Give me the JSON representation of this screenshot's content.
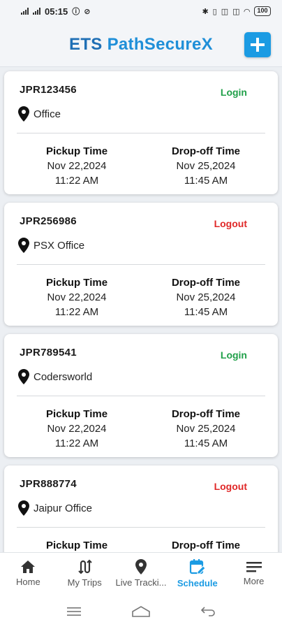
{
  "status_bar": {
    "time": "05:15",
    "battery": "100"
  },
  "header": {
    "title_part1": "ETS ",
    "title_part2": "PathSecureX"
  },
  "trips": [
    {
      "id": "JPR123456",
      "status": "Login",
      "location": "Office",
      "pickup_label": "Pickup Time",
      "pickup_date": "Nov 22,2024",
      "pickup_time": "11:22 AM",
      "dropoff_label": "Drop-off Time",
      "dropoff_date": "Nov 25,2024",
      "dropoff_time": "11:45 AM"
    },
    {
      "id": "JPR256986",
      "status": "Logout",
      "location": "PSX Office",
      "pickup_label": "Pickup Time",
      "pickup_date": "Nov 22,2024",
      "pickup_time": "11:22 AM",
      "dropoff_label": "Drop-off Time",
      "dropoff_date": "Nov 25,2024",
      "dropoff_time": "11:45 AM"
    },
    {
      "id": "JPR789541",
      "status": "Login",
      "location": "Codersworld",
      "pickup_label": "Pickup Time",
      "pickup_date": "Nov 22,2024",
      "pickup_time": "11:22 AM",
      "dropoff_label": "Drop-off Time",
      "dropoff_date": "Nov 25,2024",
      "dropoff_time": "11:45 AM"
    },
    {
      "id": "JPR888774",
      "status": "Logout",
      "location": "Jaipur Office",
      "pickup_label": "Pickup Time",
      "pickup_date": "",
      "pickup_time": "",
      "dropoff_label": "Drop-off Time",
      "dropoff_date": "",
      "dropoff_time": ""
    }
  ],
  "colors": {
    "login": "#21a04a",
    "logout": "#e02828",
    "accent": "#1b9be3"
  },
  "bottom_nav": [
    {
      "label": "Home",
      "icon": "home-icon"
    },
    {
      "label": "My Trips",
      "icon": "route-icon"
    },
    {
      "label": "Live Tracki...",
      "icon": "location-pin-icon"
    },
    {
      "label": "Schedule",
      "icon": "calendar-edit-icon",
      "active": true
    },
    {
      "label": "More",
      "icon": "menu-icon"
    }
  ]
}
